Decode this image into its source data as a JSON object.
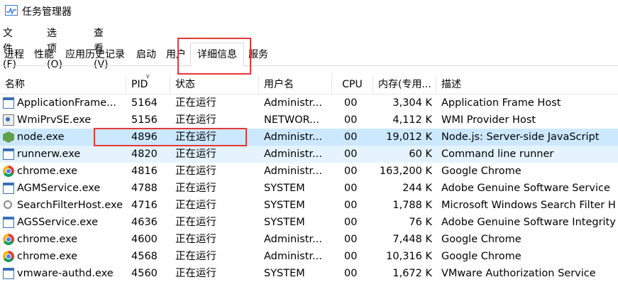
{
  "window": {
    "title": "任务管理器",
    "icon": "task-manager-icon"
  },
  "menu": [
    {
      "label": "文件(F)"
    },
    {
      "label": "选项(O)"
    },
    {
      "label": "查看(V)"
    }
  ],
  "tabs": [
    {
      "label": "进程"
    },
    {
      "label": "性能"
    },
    {
      "label": "应用历史记录"
    },
    {
      "label": "启动"
    },
    {
      "label": "用户"
    },
    {
      "label": "详细信息",
      "active": true
    },
    {
      "label": "服务"
    }
  ],
  "table": {
    "columns": [
      "名称",
      "PID",
      "状态",
      "用户名",
      "CPU",
      "内存(专用...",
      "描述"
    ],
    "sorted_column": "PID",
    "rows": [
      {
        "icon": "window-icon",
        "name": "ApplicationFrame...",
        "pid": "5164",
        "status": "正在运行",
        "user": "Administr...",
        "cpu": "00",
        "mem": "3,304 K",
        "desc": "Application Frame Host"
      },
      {
        "icon": "service-icon",
        "name": "WmiPrvSE.exe",
        "pid": "5156",
        "status": "正在运行",
        "user": "NETWOR...",
        "cpu": "00",
        "mem": "4,112 K",
        "desc": "WMI Provider Host"
      },
      {
        "icon": "node-icon",
        "name": "node.exe",
        "pid": "4896",
        "status": "正在运行",
        "user": "Administr...",
        "cpu": "00",
        "mem": "19,012 K",
        "desc": "Node.js: Server-side JavaScript",
        "selected": true
      },
      {
        "icon": "window-icon",
        "name": "runnerw.exe",
        "pid": "4820",
        "status": "正在运行",
        "user": "Administr...",
        "cpu": "00",
        "mem": "60 K",
        "desc": "Command line runner",
        "hover": true
      },
      {
        "icon": "chrome-icon",
        "name": "chrome.exe",
        "pid": "4816",
        "status": "正在运行",
        "user": "Administr...",
        "cpu": "00",
        "mem": "163,200 K",
        "desc": "Google Chrome"
      },
      {
        "icon": "window-icon",
        "name": "AGMService.exe",
        "pid": "4788",
        "status": "正在运行",
        "user": "SYSTEM",
        "cpu": "00",
        "mem": "244 K",
        "desc": "Adobe Genuine Software Service"
      },
      {
        "icon": "search-icon",
        "name": "SearchFilterHost.exe",
        "pid": "4716",
        "status": "正在运行",
        "user": "SYSTEM",
        "cpu": "00",
        "mem": "1,788 K",
        "desc": "Microsoft Windows Search Filter H"
      },
      {
        "icon": "window-icon",
        "name": "AGSService.exe",
        "pid": "4636",
        "status": "正在运行",
        "user": "SYSTEM",
        "cpu": "00",
        "mem": "76 K",
        "desc": "Adobe Genuine Software Integrity"
      },
      {
        "icon": "chrome-icon",
        "name": "chrome.exe",
        "pid": "4600",
        "status": "正在运行",
        "user": "Administr...",
        "cpu": "00",
        "mem": "7,448 K",
        "desc": "Google Chrome"
      },
      {
        "icon": "chrome-icon",
        "name": "chrome.exe",
        "pid": "4568",
        "status": "正在运行",
        "user": "Administr...",
        "cpu": "00",
        "mem": "10,316 K",
        "desc": "Google Chrome"
      },
      {
        "icon": "window-icon",
        "name": "vmware-authd.exe",
        "pid": "4560",
        "status": "正在运行",
        "user": "SYSTEM",
        "cpu": "00",
        "mem": "1,672 K",
        "desc": "VMware Authorization Service"
      }
    ]
  },
  "colors": {
    "selected_row": "#cce8ff",
    "hover_row": "#e5f3ff",
    "annotation": "#e53935"
  }
}
